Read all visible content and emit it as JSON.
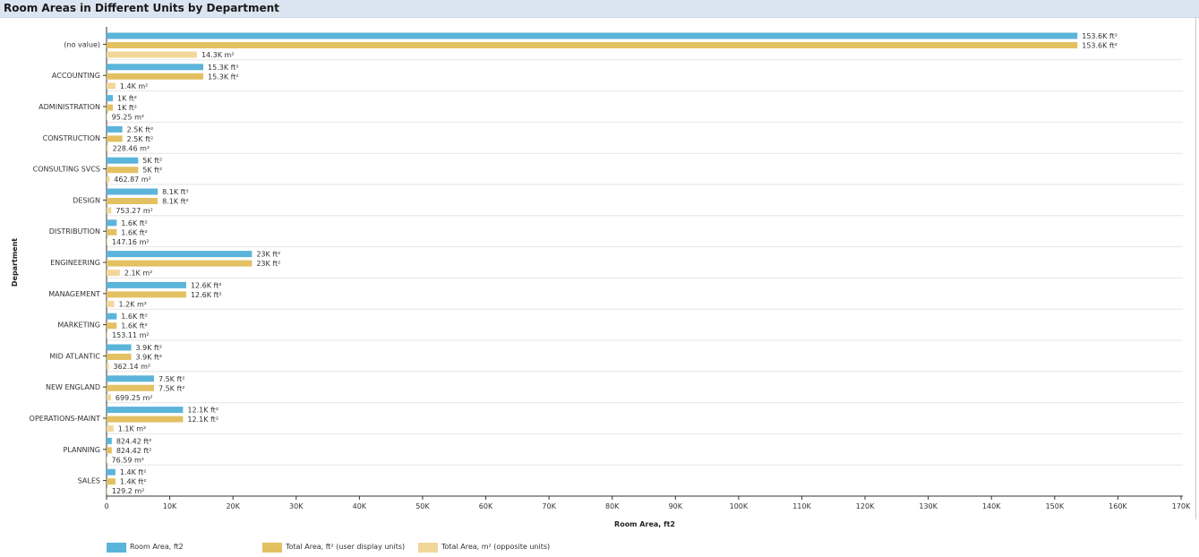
{
  "header": {
    "title": "Room Areas in Different Units by Department"
  },
  "colors": {
    "room_area": "#5bb4da",
    "total_ft2": "#e3c162",
    "total_m2": "#f2d79a"
  },
  "chart_data": {
    "type": "bar",
    "orientation": "horizontal",
    "ylabel": "Department",
    "xlabel": "Room Area, ft2",
    "xlim": [
      0,
      170000
    ],
    "xticks": [
      {
        "value": 0,
        "label": "0"
      },
      {
        "value": 10000,
        "label": "10K"
      },
      {
        "value": 20000,
        "label": "20K"
      },
      {
        "value": 30000,
        "label": "30K"
      },
      {
        "value": 40000,
        "label": "40K"
      },
      {
        "value": 50000,
        "label": "50K"
      },
      {
        "value": 60000,
        "label": "60K"
      },
      {
        "value": 70000,
        "label": "70K"
      },
      {
        "value": 80000,
        "label": "80K"
      },
      {
        "value": 90000,
        "label": "90K"
      },
      {
        "value": 100000,
        "label": "100K"
      },
      {
        "value": 110000,
        "label": "110K"
      },
      {
        "value": 120000,
        "label": "120K"
      },
      {
        "value": 130000,
        "label": "130K"
      },
      {
        "value": 140000,
        "label": "140K"
      },
      {
        "value": 150000,
        "label": "150K"
      },
      {
        "value": 160000,
        "label": "160K"
      },
      {
        "value": 170000,
        "label": "170K"
      }
    ],
    "categories": [
      "(no value)",
      "ACCOUNTING",
      "ADMINISTRATION",
      "CONSTRUCTION",
      "CONSULTING SVCS",
      "DESIGN",
      "DISTRIBUTION",
      "ENGINEERING",
      "MANAGEMENT",
      "MARKETING",
      "MID ATLANTIC",
      "NEW ENGLAND",
      "OPERATIONS-MAINT",
      "PLANNING",
      "SALES"
    ],
    "series": [
      {
        "name": "Room Area, ft2",
        "values": [
          153600,
          15300,
          1000,
          2500,
          5000,
          8100,
          1600,
          23000,
          12600,
          1600,
          3900,
          7500,
          12100,
          824.42,
          1400
        ],
        "labels": [
          "153.6K ft²",
          "15.3K ft²",
          "1K ft²",
          "2.5K ft²",
          "5K ft²",
          "8.1K ft²",
          "1.6K ft²",
          "23K ft²",
          "12.6K ft²",
          "1.6K ft²",
          "3.9K ft²",
          "7.5K ft²",
          "12.1K ft²",
          "824.42 ft²",
          "1.4K ft²"
        ]
      },
      {
        "name": "Total Area, ft² (user display units)",
        "values": [
          153600,
          15300,
          1000,
          2500,
          5000,
          8100,
          1600,
          23000,
          12600,
          1600,
          3900,
          7500,
          12100,
          824.42,
          1400
        ],
        "labels": [
          "153.6K ft²",
          "15.3K ft²",
          "1K ft²",
          "2.5K ft²",
          "5K ft²",
          "8.1K ft²",
          "1.6K ft²",
          "23K ft²",
          "12.6K ft²",
          "1.6K ft²",
          "3.9K ft²",
          "7.5K ft²",
          "12.1K ft²",
          "824.42 ft²",
          "1.4K ft²"
        ]
      },
      {
        "name": "Total Area, m² (opposite units)",
        "values": [
          14300,
          1400,
          95.25,
          228.46,
          462.87,
          753.27,
          147.16,
          2100,
          1200,
          153.11,
          362.14,
          699.25,
          1100,
          76.59,
          129.2
        ],
        "labels": [
          "14.3K m²",
          "1.4K m²",
          "95.25 m²",
          "228.46 m²",
          "462.87 m²",
          "753.27 m²",
          "147.16 m²",
          "2.1K m²",
          "1.2K m²",
          "153.11 m²",
          "362.14 m²",
          "699.25 m²",
          "1.1K m²",
          "76.59 m²",
          "129.2 m²"
        ]
      }
    ],
    "grid": "horizontal separators",
    "legend": "bottom-left"
  }
}
